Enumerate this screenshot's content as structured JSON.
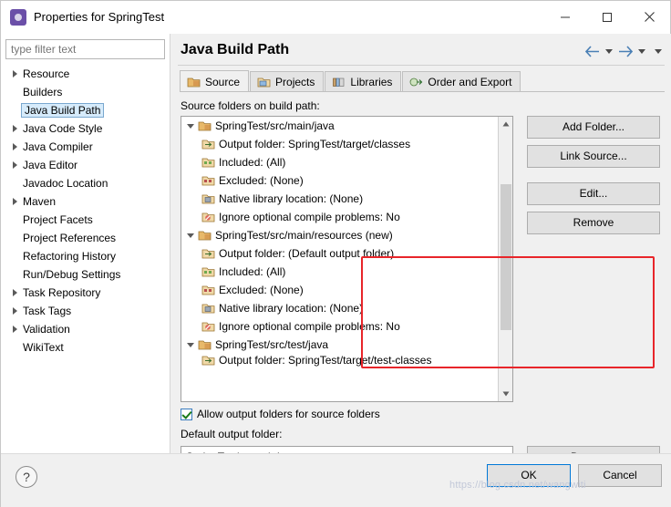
{
  "window": {
    "title": "Properties for SpringTest",
    "app_icon": "eclipse-icon",
    "minimize": "minimize-icon",
    "maximize": "maximize-icon",
    "close": "close-icon"
  },
  "filter": {
    "placeholder": "type filter text",
    "value": ""
  },
  "tree": {
    "items": [
      {
        "label": "Resource",
        "expandable": true,
        "selected": false
      },
      {
        "label": "Builders",
        "expandable": false,
        "selected": false
      },
      {
        "label": "Java Build Path",
        "expandable": false,
        "selected": true
      },
      {
        "label": "Java Code Style",
        "expandable": true,
        "selected": false
      },
      {
        "label": "Java Compiler",
        "expandable": true,
        "selected": false
      },
      {
        "label": "Java Editor",
        "expandable": true,
        "selected": false
      },
      {
        "label": "Javadoc Location",
        "expandable": false,
        "selected": false
      },
      {
        "label": "Maven",
        "expandable": true,
        "selected": false
      },
      {
        "label": "Project Facets",
        "expandable": false,
        "selected": false
      },
      {
        "label": "Project References",
        "expandable": false,
        "selected": false
      },
      {
        "label": "Refactoring History",
        "expandable": false,
        "selected": false
      },
      {
        "label": "Run/Debug Settings",
        "expandable": false,
        "selected": false
      },
      {
        "label": "Task Repository",
        "expandable": true,
        "selected": false
      },
      {
        "label": "Task Tags",
        "expandable": true,
        "selected": false
      },
      {
        "label": "Validation",
        "expandable": true,
        "selected": false
      },
      {
        "label": "WikiText",
        "expandable": false,
        "selected": false
      }
    ]
  },
  "page": {
    "title": "Java Build Path",
    "nav": {
      "back": "back-arrow-icon",
      "back_menu": "chevron-down-icon",
      "forward": "forward-arrow-icon",
      "forward_menu": "chevron-down-icon",
      "view_menu": "chevron-down-icon"
    }
  },
  "tabs": [
    {
      "label": "Source",
      "icon": "source-folder-icon",
      "active": true
    },
    {
      "label": "Projects",
      "icon": "projects-icon",
      "active": false
    },
    {
      "label": "Libraries",
      "icon": "libraries-icon",
      "active": false
    },
    {
      "label": "Order and Export",
      "icon": "order-export-icon",
      "active": false
    }
  ],
  "content": {
    "label": "Source folders on build path:",
    "rows": [
      {
        "text": "SpringTest/src/main/java",
        "kind": "root",
        "icon": "source-folder-icon",
        "indent": 0
      },
      {
        "text": "Output folder: SpringTest/target/classes",
        "kind": "child",
        "icon": "output-folder-icon",
        "indent": 1
      },
      {
        "text": "Included: (All)",
        "kind": "child",
        "icon": "include-icon",
        "indent": 1
      },
      {
        "text": "Excluded: (None)",
        "kind": "child",
        "icon": "exclude-icon",
        "indent": 1
      },
      {
        "text": "Native library location: (None)",
        "kind": "child",
        "icon": "native-lib-icon",
        "indent": 1
      },
      {
        "text": "Ignore optional compile problems: No",
        "kind": "child",
        "icon": "ignore-problems-icon",
        "indent": 1
      },
      {
        "text": "SpringTest/src/main/resources (new)",
        "kind": "root",
        "icon": "source-folder-icon",
        "indent": 0
      },
      {
        "text": "Output folder: (Default output folder)",
        "kind": "child",
        "icon": "output-folder-icon",
        "indent": 1
      },
      {
        "text": "Included: (All)",
        "kind": "child",
        "icon": "include-icon",
        "indent": 1
      },
      {
        "text": "Excluded: (None)",
        "kind": "child",
        "icon": "exclude-icon",
        "indent": 1
      },
      {
        "text": "Native library location: (None)",
        "kind": "child",
        "icon": "native-lib-icon",
        "indent": 1
      },
      {
        "text": "Ignore optional compile problems: No",
        "kind": "child",
        "icon": "ignore-problems-icon",
        "indent": 1
      },
      {
        "text": "SpringTest/src/test/java",
        "kind": "root",
        "icon": "source-folder-icon",
        "indent": 0
      },
      {
        "text": "Output folder: SpringTest/target/test-classes",
        "kind": "child",
        "icon": "output-folder-icon",
        "indent": 1
      }
    ],
    "highlight_color": "#e8252a"
  },
  "side_buttons": [
    {
      "label": "Add Folder...",
      "name": "add-folder-button"
    },
    {
      "label": "Link Source...",
      "name": "link-source-button"
    },
    {
      "label": "Edit...",
      "name": "edit-button"
    },
    {
      "label": "Remove",
      "name": "remove-button"
    }
  ],
  "bottom": {
    "allow_output_label": "Allow output folders for source folders",
    "allow_output_checked": true,
    "default_output_label": "Default output folder:",
    "default_output_value": "SpringTest\\target\\classes",
    "browse_label": "Browse..."
  },
  "footer": {
    "help": "?",
    "ok": "OK",
    "cancel": "Cancel"
  },
  "watermark": "https://blog.csdn.net/wangwiti"
}
